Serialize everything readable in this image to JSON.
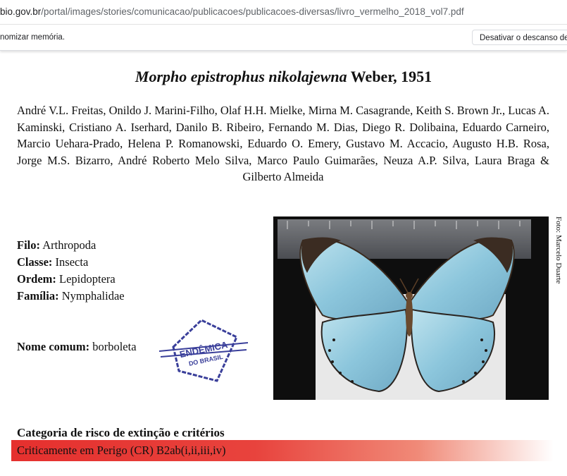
{
  "browser": {
    "url_host": "bio.gov.br",
    "url_path": "/portal/images/stories/comunicacao/publicacoes/publicacoes-diversas/livro_vermelho_2018_vol7.pdf",
    "infobar_message": "nomizar memória.",
    "infobar_button": "Desativar o descanso de"
  },
  "document": {
    "title_species": "Morpho epistrophus nikolajewna",
    "title_author": " Weber, 1951",
    "authors": "André V.L. Freitas, Onildo J. Marini-Filho, Olaf H.H. Mielke, Mirna M. Casagrande, Keith S. Brown Jr., Lucas A. Kaminski, Cristiano A. Iserhard, Danilo B. Ribeiro, Fernando M. Dias, Diego R. Dolibaina, Eduardo Carneiro, Marcio Uehara-Prado, Helena P. Romanowski, Eduardo O. Emery, Gustavo M. Accacio, Augusto H.B. Rosa, Jorge M.S. Bizarro, André Roberto Melo Silva, Marco Paulo Guimarães, Neuza A.P. Silva, Laura Braga & Gilberto Almeida",
    "taxonomy": [
      {
        "label": "Filo:",
        "value": " Arthropoda"
      },
      {
        "label": "Classe:",
        "value": " Insecta"
      },
      {
        "label": "Ordem:",
        "value": " Lepidoptera"
      },
      {
        "label": "Família:",
        "value": " Nymphalidae"
      }
    ],
    "common_name_label": "Nome comum:",
    "common_name_value": " borboleta",
    "photo_credit": "Foto: Marcelo Duarte",
    "stamp_text_1": "ENDÊMICA",
    "stamp_text_2": "DO BRASIL",
    "category_heading": "Categoria de risco de extinção e critérios",
    "category_value": "Criticamente em Perigo (CR) B2ab(i,ii,iii,iv)"
  },
  "colors": {
    "risk_red": "#e5302e",
    "stamp_blue": "#3a3f9a",
    "wing_blue": "#8cc6dc"
  }
}
